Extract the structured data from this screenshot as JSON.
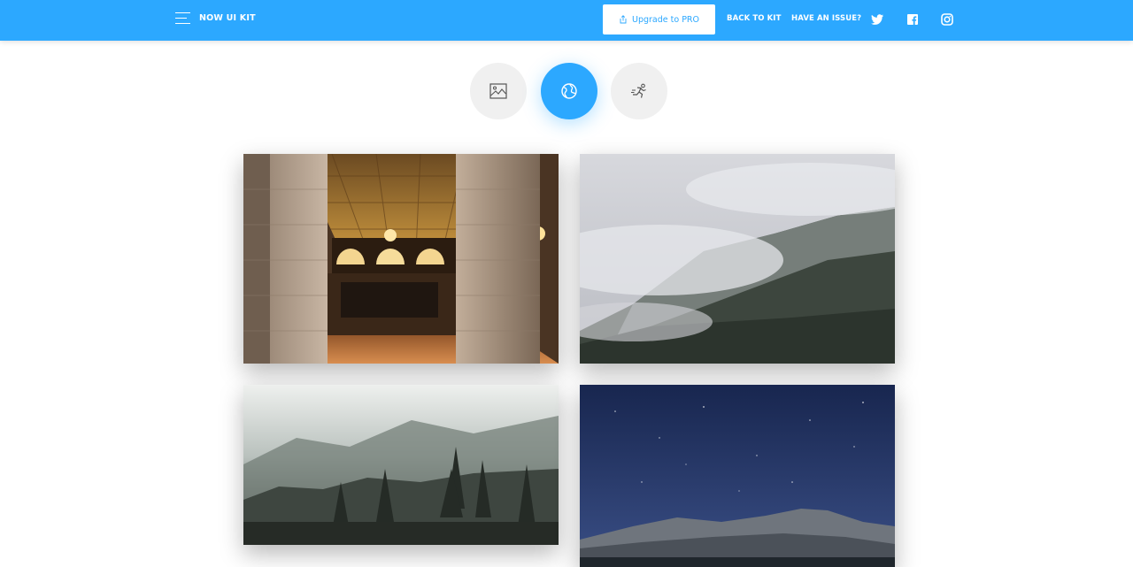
{
  "navbar": {
    "brand": "NOW UI KIT",
    "upgrade_label": "Upgrade to PRO",
    "links": {
      "back": "BACK TO KIT",
      "issue": "HAVE AN ISSUE?"
    },
    "social": [
      "twitter-icon",
      "facebook-icon",
      "instagram-icon"
    ]
  },
  "tabs": [
    {
      "icon": "image-icon",
      "active": false
    },
    {
      "icon": "world-icon",
      "active": true
    },
    {
      "icon": "running-person-icon",
      "active": false
    }
  ],
  "gallery": [
    {
      "subject": "interior-hall-photo"
    },
    {
      "subject": "snowy-mountain-photo"
    },
    {
      "subject": "foggy-forest-photo"
    },
    {
      "subject": "night-sky-mountain-photo"
    }
  ],
  "colors": {
    "primary": "#2ca8ff",
    "pill_bg": "#f0f0f0"
  }
}
